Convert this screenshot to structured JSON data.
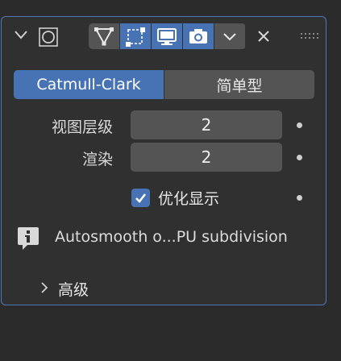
{
  "header": {
    "icons": [
      "chevron-down-icon",
      "modifier-subdivision-icon",
      "edit-mode-icon",
      "cage-icon",
      "realtime-display-icon",
      "render-camera-icon",
      "dropdown-chevron-icon",
      "close-icon",
      "drag-handle-icon"
    ],
    "active_color": "#4772b3"
  },
  "subdivision_type": {
    "options": [
      "Catmull-Clark",
      "简单型"
    ],
    "selected": "Catmull-Clark"
  },
  "fields": {
    "viewport_levels": {
      "label": "视图层级",
      "value": "2"
    },
    "render_levels": {
      "label": "渲染",
      "value": "2"
    }
  },
  "optimal_display": {
    "label": "优化显示",
    "checked": true
  },
  "info": {
    "text": "Autosmooth o...PU subdivision"
  },
  "advanced": {
    "label": "高级"
  },
  "colors": {
    "panel_border": "#4e79b8",
    "panel_bg": "#303030",
    "field_bg": "#545454"
  }
}
